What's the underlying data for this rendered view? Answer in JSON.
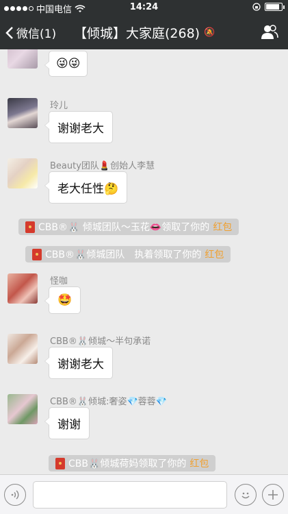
{
  "status_bar": {
    "carrier": "中国电信",
    "time": "14:24",
    "signal_bars_filled": 4,
    "signal_bars_total": 5,
    "battery_level": 0.85
  },
  "navbar": {
    "back_label": "微信(1)",
    "title": "【倾城】大家庭(268)",
    "mute_icon": "mute-bell-icon",
    "members_icon": "people-icon"
  },
  "messages": [
    {
      "sender": "",
      "text": "",
      "emojis": "😜😜"
    },
    {
      "sender": "玲儿",
      "text": "谢谢老大"
    },
    {
      "sender": "Beauty团队💄创始人李慧",
      "text": "老大任性🤔"
    },
    {
      "sender": "怪咖",
      "text": "",
      "emojis": "🤩"
    },
    {
      "sender": "CBB®🐰倾城～半句承诺",
      "text": "谢谢老大"
    },
    {
      "sender": "CBB®🐰倾城:奢姿💎蓉蓉💎",
      "text": "谢谢"
    }
  ],
  "system_messages": [
    {
      "text": "CBB®🐰 倾城团队～玉花👄领取了你的",
      "link": "红包"
    },
    {
      "text": "CBB®🐰倾城团队　执着领取了你的",
      "link": "红包"
    },
    {
      "text": "CBB🐰倾城荷妈领取了你的",
      "link": "红包"
    }
  ],
  "input_bar": {
    "voice_icon": "voice-icon",
    "emoji_icon": "smiley-icon",
    "plus_icon": "plus-icon",
    "placeholder": ""
  },
  "colors": {
    "navbar": "#2e3132",
    "chat_bg": "#ebebeb",
    "system_bubble": "#cfcfcf",
    "hongbao_link": "#f0a030",
    "red_packet": "#d53a2c"
  }
}
